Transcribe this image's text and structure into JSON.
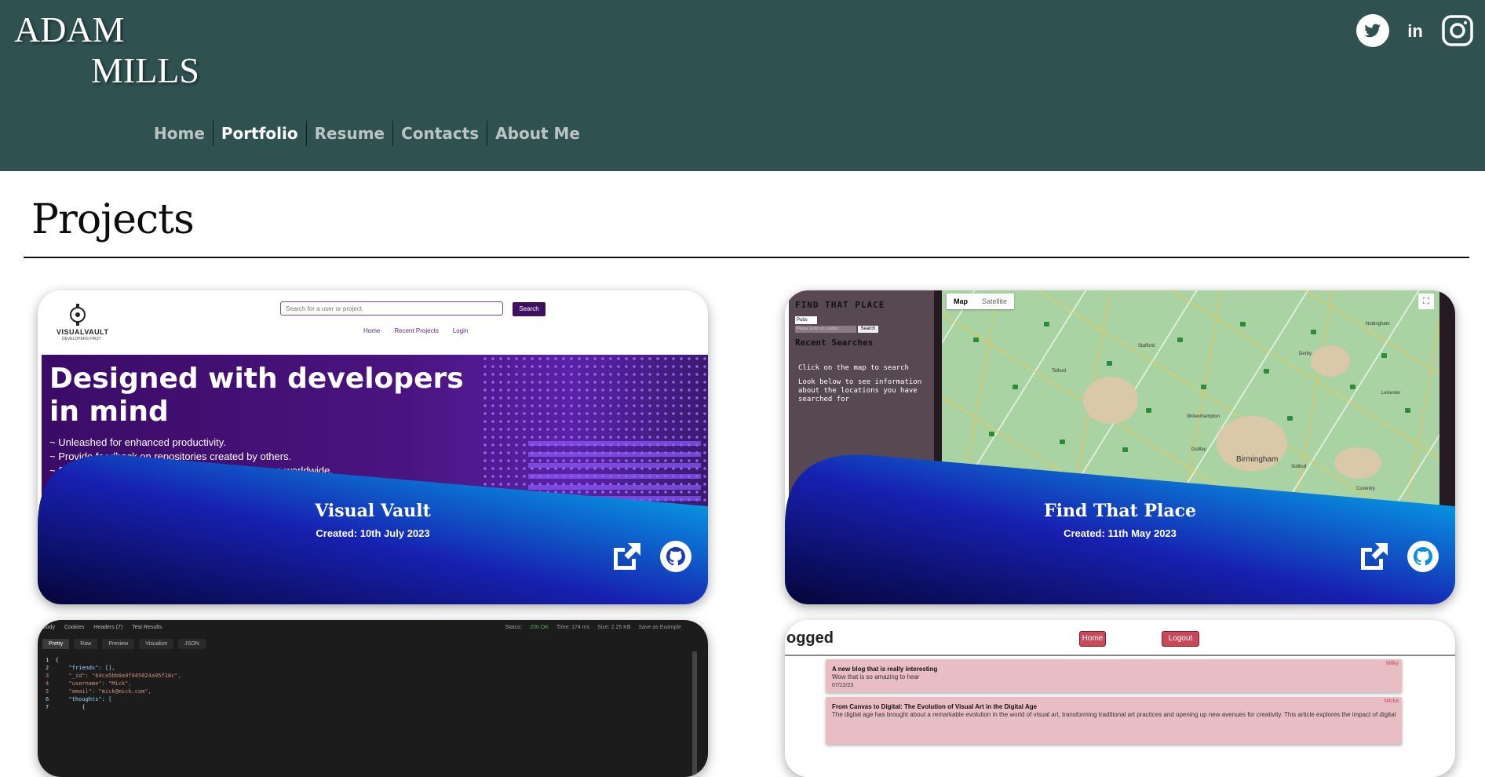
{
  "logo": {
    "line1": "ADAM",
    "line2": "MILLS"
  },
  "social": [
    "twitter-icon",
    "linkedin-icon",
    "instagram-icon"
  ],
  "nav": {
    "items": [
      "Home",
      "Portfolio",
      "Resume",
      "Contacts",
      "About Me"
    ],
    "active": "Portfolio"
  },
  "section_title": "Projects",
  "colors": {
    "header": "#2f5150",
    "nav_active": "#ffffff",
    "nav_inactive": "#b9c4c3",
    "card_gradient_start": "#06053a",
    "card_gradient_mid": "#1720b0",
    "card_gradient_end": "#00c6f5"
  },
  "projects": [
    {
      "title": "Visual Vault",
      "date": "Created: 10th July 2023",
      "links": [
        "external-link-icon",
        "github-icon"
      ],
      "screenshot": {
        "logo": "VISUALVAULT",
        "logo_sub": "DEVELOPERS FIRST",
        "search_placeholder": "Search for a user or project",
        "search_button": "Search",
        "nav": [
          "Home",
          "Recent Projects",
          "Login"
        ],
        "hero_heading": "Designed with developers in mind",
        "hero_lines": [
          "~ Unleashed for enhanced productivity.",
          "~ Provide feedback on repositories created by others.",
          "~ Share your projects with thousands of developers worldwide."
        ]
      }
    },
    {
      "title": "Find That Place",
      "date": "Created: 11th May 2023",
      "links": [
        "external-link-icon",
        "github-icon"
      ],
      "screenshot": {
        "heading": "FIND THAT PLACE",
        "select_value": "Pubs",
        "input_placeholder": "Please Enter a Location",
        "search_button": "Search",
        "recent_heading": "Recent Searches",
        "hint1": "Click on the map to search",
        "hint2": "Look below to see information about the locations you have searched for",
        "map_tabs": [
          "Map",
          "Satellite"
        ],
        "map_labels": [
          "Birmingham",
          "Wolverhampton",
          "Coventry",
          "Stafford",
          "Telford",
          "Leicester",
          "Nottingham",
          "Derby",
          "Solihull",
          "Dudley"
        ]
      }
    },
    {
      "title": "",
      "screenshot": {
        "tabs": [
          "Body",
          "Cookies",
          "Headers (7)",
          "Test Results"
        ],
        "status": [
          "Status:",
          "200 OK",
          "Time: 174 ms",
          "Size: 2.25 KB",
          "Save as Example"
        ],
        "subtabs": [
          "Pretty",
          "Raw",
          "Preview",
          "Visualize",
          "JSON"
        ],
        "code": [
          "1  {",
          "2      \"friends\": [],",
          "3      \"_id\": \"64ca5bb8a9f045024a95f18c\",",
          "4      \"username\": \"Mick\",",
          "5      \"email\": \"mick@mick.com\",",
          "6      \"thoughts\": [",
          "7          {"
        ]
      }
    },
    {
      "title": "",
      "screenshot": {
        "heading": "ogged",
        "buttons": [
          "Home",
          "Logout"
        ],
        "posts": [
          {
            "title": "A new blog that is really interesting",
            "body": "Wow that is so amazing to hear",
            "date": "07/12/23",
            "user": "Milky"
          },
          {
            "title": "From Canvas to Digital: The Evolution of Visual Art in the Digital Age",
            "body": "The digital age has brought about a remarkable evolution in the world of visual art, transforming traditional art practices and opening up new avenues for creativity. This article explores the impact of digital tech",
            "date": "",
            "user": "Micka"
          }
        ]
      }
    }
  ]
}
